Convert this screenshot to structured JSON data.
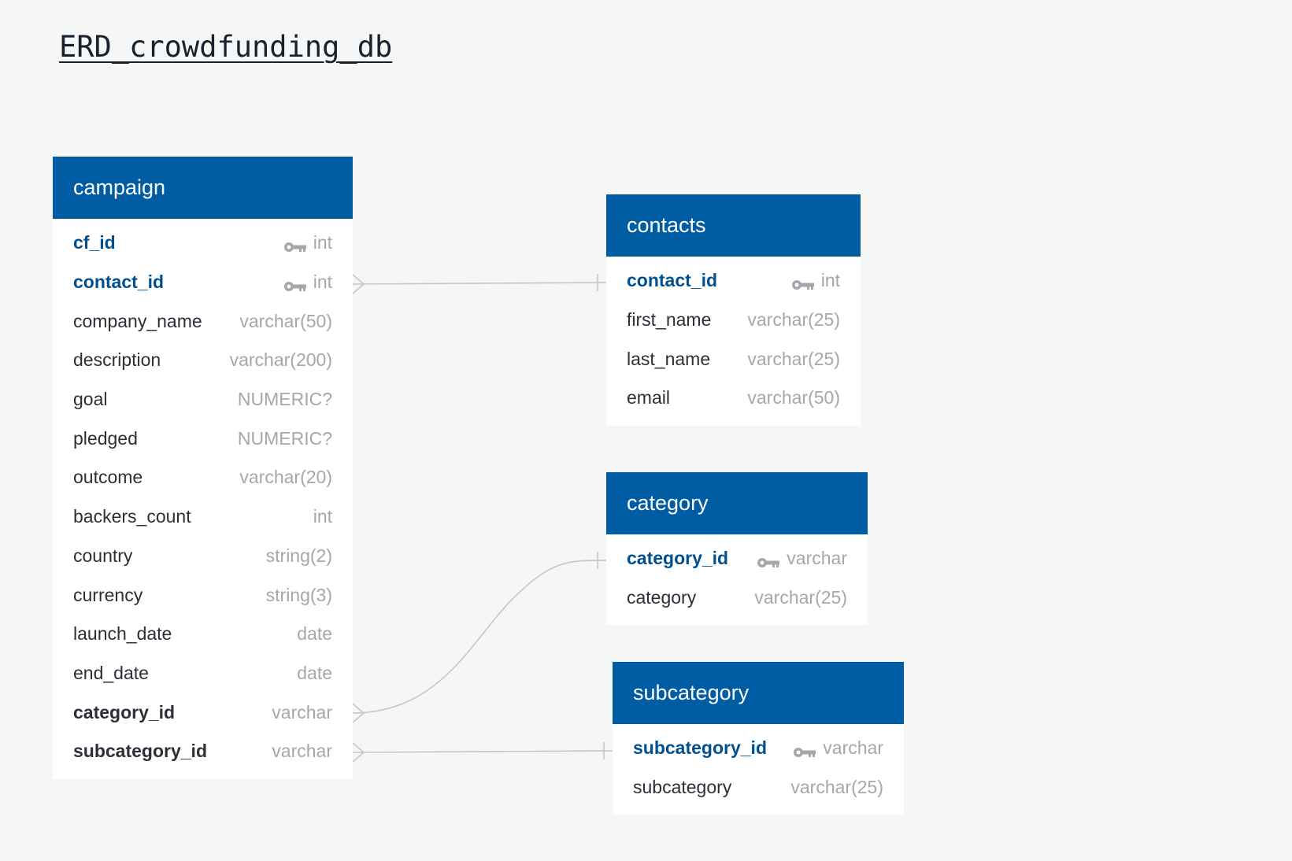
{
  "title": "ERD_crowdfunding_db",
  "colors": {
    "header": "#005ca3",
    "primary_key_text": "#00508f",
    "type_text": "#a4a7ac",
    "connector": "#c4c6c8"
  },
  "entities": {
    "campaign": {
      "name": "campaign",
      "fields": [
        {
          "name": "cf_id",
          "type": "int",
          "role": "pk",
          "icon": "key-icon"
        },
        {
          "name": "contact_id",
          "type": "int",
          "role": "pk",
          "icon": "key-icon"
        },
        {
          "name": "company_name",
          "type": "varchar(50)",
          "role": "plain"
        },
        {
          "name": "description",
          "type": "varchar(200)",
          "role": "plain"
        },
        {
          "name": "goal",
          "type": "NUMERIC?",
          "role": "plain"
        },
        {
          "name": "pledged",
          "type": "NUMERIC?",
          "role": "plain"
        },
        {
          "name": "outcome",
          "type": "varchar(20)",
          "role": "plain"
        },
        {
          "name": "backers_count",
          "type": "int",
          "role": "plain"
        },
        {
          "name": "country",
          "type": "string(2)",
          "role": "plain"
        },
        {
          "name": "currency",
          "type": "string(3)",
          "role": "plain"
        },
        {
          "name": "launch_date",
          "type": "date",
          "role": "plain"
        },
        {
          "name": "end_date",
          "type": "date",
          "role": "plain"
        },
        {
          "name": "category_id",
          "type": "varchar",
          "role": "fk"
        },
        {
          "name": "subcategory_id",
          "type": "varchar",
          "role": "fk"
        }
      ]
    },
    "contacts": {
      "name": "contacts",
      "fields": [
        {
          "name": "contact_id",
          "type": "int",
          "role": "pk",
          "icon": "key-icon"
        },
        {
          "name": "first_name",
          "type": "varchar(25)",
          "role": "plain"
        },
        {
          "name": "last_name",
          "type": "varchar(25)",
          "role": "plain"
        },
        {
          "name": "email",
          "type": "varchar(50)",
          "role": "plain"
        }
      ]
    },
    "category": {
      "name": "category",
      "fields": [
        {
          "name": "category_id",
          "type": "varchar",
          "role": "pk",
          "icon": "key-icon"
        },
        {
          "name": "category",
          "type": "varchar(25)",
          "role": "plain"
        }
      ]
    },
    "subcategory": {
      "name": "subcategory",
      "fields": [
        {
          "name": "subcategory_id",
          "type": "varchar",
          "role": "pk",
          "icon": "key-icon"
        },
        {
          "name": "subcategory",
          "type": "varchar(25)",
          "role": "plain"
        }
      ]
    }
  },
  "relationships": [
    {
      "from": "campaign.contact_id",
      "to": "contacts.contact_id",
      "from_cardinality": "many",
      "to_cardinality": "one"
    },
    {
      "from": "campaign.category_id",
      "to": "category.category_id",
      "from_cardinality": "many",
      "to_cardinality": "one"
    },
    {
      "from": "campaign.subcategory_id",
      "to": "subcategory.subcategory_id",
      "from_cardinality": "many",
      "to_cardinality": "one"
    }
  ]
}
